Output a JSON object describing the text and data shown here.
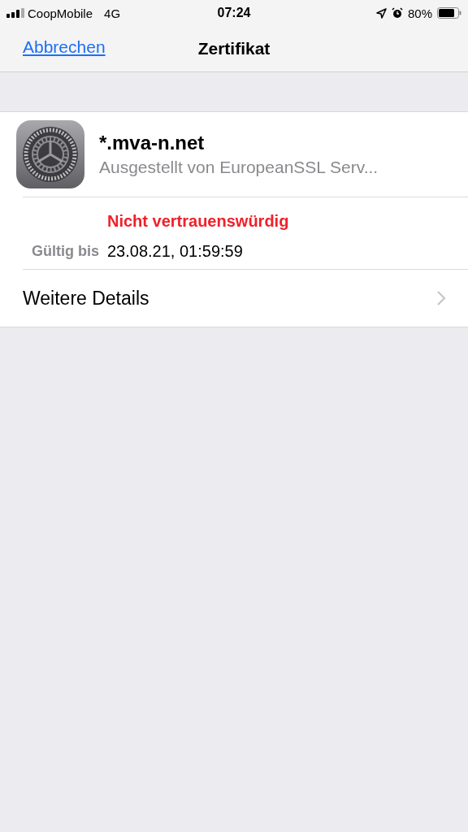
{
  "status_bar": {
    "carrier": "CoopMobile",
    "network": "4G",
    "time": "07:24",
    "battery": "80%"
  },
  "nav_bar": {
    "cancel": "Abbrechen",
    "title": "Zertifikat"
  },
  "certificate": {
    "name": "*.mva-n.net",
    "issuer": "Ausgestellt von EuropeanSSL Serv...",
    "trust_status": "Nicht vertrauenswürdig",
    "valid_label": "Gültig bis",
    "valid_value": "23.08.21, 01:59:59"
  },
  "more_details": "Weitere Details"
}
